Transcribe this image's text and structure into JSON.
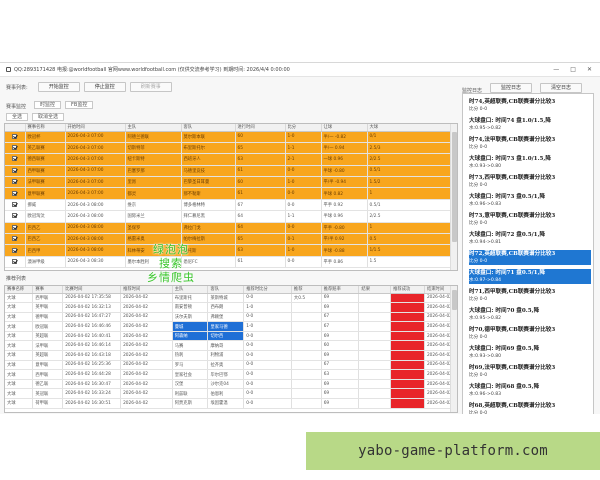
{
  "window": {
    "title": "QQ:2893171428 电报:@worldfootball 官网www.worldfootball.com (仅供交流参考学习)   到期时间: 2026/4/4 0:00:00",
    "controls": [
      "—",
      "□",
      "✕"
    ]
  },
  "toolbar": {
    "label": "赛事列表:",
    "btn_start": "开始监控",
    "btn_stop": "停止监控",
    "btn_clear": "刷新赛事",
    "btn_log": "监控日志",
    "btn_clear_log": "清空日志",
    "right_label": "监控日志"
  },
  "top_section": {
    "group_label": "赛事监控",
    "sub_options": [
      "时监控",
      "FB监控"
    ],
    "filter_buttons": [
      "全选",
      "取消全选"
    ]
  },
  "top_table": {
    "headers": [
      "",
      "赛事名称",
      "开始时间",
      "主队",
      "客队",
      "进行时间",
      "比分",
      "让球",
      "大球"
    ],
    "rows": [
      {
        "style": "orange",
        "checked": true,
        "cells": [
          "欧冠杯",
          "2026-04-3 07:00",
          "阿德兰德联",
          "莫尔斯本联",
          "60",
          "1-0",
          "半/一 -0.82",
          "0/1"
        ]
      },
      {
        "style": "orange",
        "checked": true,
        "cells": [
          "英乙联赛",
          "2026-04-3 07:00",
          "切斯特菲",
          "布里斯托尔",
          "65",
          "1-1",
          "半/一 0.94",
          "2.5/3"
        ]
      },
      {
        "style": "orange",
        "checked": true,
        "cells": [
          "德西联赛",
          "2026-04-3 07:00",
          "纽卡斯特",
          "西班牙人",
          "63",
          "2-1",
          "一球 0.96",
          "2/2.5"
        ]
      },
      {
        "style": "orange",
        "checked": true,
        "cells": [
          "西甲联赛",
          "2026-04-3 07:00",
          "巴塞罗那",
          "马德里竞技",
          "61",
          "0-0",
          "半球 -0.80",
          "0.5/1"
        ]
      },
      {
        "style": "orange",
        "checked": true,
        "cells": [
          "法甲联赛",
          "2026-04-3 07:00",
          "里昂",
          "巴黎圣日耳曼",
          "60",
          "1-0",
          "平/半 -0.94",
          "1.5/2"
        ]
      },
      {
        "style": "orange",
        "checked": true,
        "cells": [
          "意甲联赛",
          "2026-04-3 07:00",
          "都灵",
          "那不勒斯",
          "61",
          "0-0",
          "半球 0.82",
          "1"
        ]
      },
      {
        "style": "white",
        "checked": true,
        "cells": [
          "挪威",
          "2026-04-3 08:00",
          "维京",
          "博多格林特",
          "67",
          "0-0",
          "平手 0.92",
          "0.5/1"
        ]
      },
      {
        "style": "white",
        "checked": true,
        "cells": [
          "欧冠淘汰",
          "2026-04-3 08:00",
          "国际米兰",
          "拜仁慕尼黑",
          "64",
          "1-1",
          "半球 0.96",
          "2/2.5"
        ]
      },
      {
        "style": "orange",
        "checked": true,
        "cells": [
          "巴西乙",
          "2026-04-3 08:00",
          "圣保罗",
          "弗拉门戈",
          "64",
          "0-0",
          "平手 -0.80",
          "1"
        ]
      },
      {
        "style": "orange",
        "checked": true,
        "cells": [
          "巴西乙",
          "2026-04-3 08:00",
          "格雷米奥",
          "帕尔梅拉斯",
          "65",
          "0-1",
          "平/半 0.92",
          "0.5"
        ]
      },
      {
        "style": "orange",
        "checked": true,
        "cells": [
          "巴西甲",
          "2026-04-3 08:00",
          "科林蒂安",
          "桑托斯",
          "63",
          "1-0",
          "半球 -0.88",
          "1/1.5"
        ]
      },
      {
        "style": "white",
        "checked": true,
        "cells": [
          "澳洲甲级",
          "2026-04-3 08:30",
          "墨尔本胜利",
          "悉尼FC",
          "61",
          "0-0",
          "平手 0.86",
          "1.5"
        ]
      }
    ]
  },
  "bottom_section": {
    "group_label": "推荐列表",
    "headers": [
      "赛事名称",
      "赛事",
      "比赛时间",
      "推荐时间",
      "主队",
      "客队",
      "推荐时比分",
      "推荐",
      "推荐赔率",
      "结果",
      "推荐成功",
      "结束时间"
    ],
    "rows": [
      {
        "cells": [
          "大球",
          "西甲联",
          "2026-04-02 17:35:58",
          "2026-04-02",
          "布里斯托",
          "莱斯特城",
          "0-0",
          "大0.5",
          "69",
          "",
          "",
          "2026-04-02"
        ],
        "red": true,
        "blue": false
      },
      {
        "cells": [
          "大球",
          "英甲联",
          "2026-04-02 16:32:13",
          "2026-04-02",
          "南安普顿",
          "西布朗",
          "1-0",
          "",
          "69",
          "",
          "",
          "2026-04-02"
        ],
        "red": true,
        "blue": false
      },
      {
        "cells": [
          "大球",
          "德甲联",
          "2026-04-02 16:47:27",
          "2026-04-02",
          "沃尔夫斯",
          "弗赖堡",
          "0-0",
          "",
          "67",
          "",
          "",
          "2026-04-02"
        ],
        "red": true,
        "blue": false
      },
      {
        "cells": [
          "大球",
          "欧冠联",
          "2026-04-02 16:46:46",
          "2026-04-02",
          "曼城",
          "皇家马德",
          "1-0",
          "",
          "67",
          "",
          "",
          "2026-04-02"
        ],
        "red": true,
        "blue": true
      },
      {
        "cells": [
          "大球",
          "英超联",
          "2026-04-02 16:40:41",
          "2026-04-02",
          "阿森纳",
          "切尔西",
          "0-0",
          "",
          "69",
          "",
          "",
          "2026-04-02"
        ],
        "red": true,
        "blue": true
      },
      {
        "cells": [
          "大球",
          "法甲联",
          "2026-04-02 16:46:14",
          "2026-04-02",
          "马赛",
          "摩纳哥",
          "0-0",
          "",
          "60",
          "",
          "",
          "2026-04-02"
        ],
        "red": true,
        "blue": false
      },
      {
        "cells": [
          "大球",
          "英超联",
          "2026-04-02 16:43:18",
          "2026-04-02",
          "热刺",
          "利物浦",
          "0-0",
          "",
          "69",
          "",
          "",
          "2026-04-02"
        ],
        "red": true,
        "blue": false
      },
      {
        "cells": [
          "大球",
          "意甲联",
          "2026-04-02 16:25:36",
          "2026-04-02",
          "罗马",
          "拉齐奥",
          "0-0",
          "",
          "67",
          "",
          "",
          "2026-04-02"
        ],
        "red": true,
        "blue": false
      },
      {
        "cells": [
          "大球",
          "西甲联",
          "2026-04-02 16:44:28",
          "2026-04-02",
          "皇家社会",
          "毕尔巴鄂",
          "0-0",
          "",
          "63",
          "",
          "",
          "2026-04-02"
        ],
        "red": true,
        "blue": false
      },
      {
        "cells": [
          "大球",
          "德乙联",
          "2026-04-02 16:30:47",
          "2026-04-02",
          "汉堡",
          "沙尔克04",
          "0-0",
          "",
          "69",
          "",
          "",
          "2026-04-02"
        ],
        "red": true,
        "blue": false
      },
      {
        "cells": [
          "大球",
          "英冠联",
          "2026-04-02 16:33:24",
          "2026-04-02",
          "利兹联",
          "伯恩利",
          "0-0",
          "",
          "69",
          "",
          "",
          "2026-04-02"
        ],
        "red": true,
        "blue": false
      },
      {
        "cells": [
          "大球",
          "荷甲联",
          "2026-04-02 16:30:51",
          "2026-04-02",
          "阿贾克斯",
          "埃因霍温",
          "0-0",
          "",
          "69",
          "",
          "",
          "2026-04-02"
        ],
        "red": true,
        "blue": false
      }
    ]
  },
  "overlay_text": [
    "绿泡泡",
    "搜索",
    "乡情爬虫"
  ],
  "log": {
    "entries": [
      {
        "l1": "时74,英超联赛,CB联赛谱分比较3",
        "l2": "比分 0-0",
        "sel": false
      },
      {
        "l1": "大球盘口: 时间74 盘1.0/1.5,降",
        "l2": "水:0.95->0.82",
        "sel": false
      },
      {
        "l1": "时74,法甲联赛,CB联赛谱分比较3",
        "l2": "比分 0-0",
        "sel": false
      },
      {
        "l1": "大球盘口: 时间73 盘1.0/1.5,降",
        "l2": "水:0.93->0.80",
        "sel": false
      },
      {
        "l1": "时73,西甲联赛,CB联赛谱分比较3",
        "l2": "比分 0-0",
        "sel": false
      },
      {
        "l1": "大球盘口: 时间73 盘0.5/1,降",
        "l2": "水:0.96->0.83",
        "sel": false
      },
      {
        "l1": "时73,意甲联赛,CB联赛谱分比较3",
        "l2": "比分 0-0",
        "sel": false
      },
      {
        "l1": "大球盘口: 时间72 盘0.5/1,降",
        "l2": "水:0.94->0.81",
        "sel": false
      },
      {
        "l1": "时72,英超联赛,CB联赛谱分比较3",
        "l2": "比分 0-0",
        "sel": true
      },
      {
        "l1": "大球盘口: 时间71 盘0.5/1,降",
        "l2": "水:0.97->0.84",
        "sel": true
      },
      {
        "l1": "时71,西甲联赛,CB联赛谱分比较3",
        "l2": "比分 0-0",
        "sel": false
      },
      {
        "l1": "大球盘口: 时间70 盘0.5,降",
        "l2": "水:0.95->0.82",
        "sel": false
      },
      {
        "l1": "时70,德甲联赛,CB联赛谱分比较3",
        "l2": "比分 0-0",
        "sel": false
      },
      {
        "l1": "大球盘口: 时间69 盘0.5,降",
        "l2": "水:0.93->0.80",
        "sel": false
      },
      {
        "l1": "时69,法甲联赛,CB联赛谱分比较3",
        "l2": "比分 0-0",
        "sel": false
      },
      {
        "l1": "大球盘口: 时间68 盘0.5,降",
        "l2": "水:0.96->0.83",
        "sel": false
      },
      {
        "l1": "时68,英超联赛,CB联赛谱分比较3",
        "l2": "比分 0-0",
        "sel": false
      }
    ]
  },
  "footer": {
    "site": "yabo-game-platform.com"
  }
}
